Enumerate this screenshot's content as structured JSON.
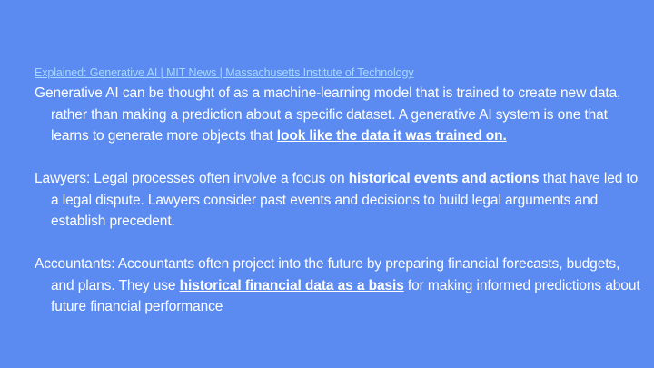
{
  "slide": {
    "source_link": "Explained: Generative AI | MIT News | Massachusetts Institute of Technology",
    "p1": {
      "text_a": "Generative AI can be thought of as a machine-learning model that is trained to create new data, rather than making a prediction about a specific dataset. A generative AI system is one that learns to generate more objects that ",
      "highlight": "look like the data it was trained on."
    },
    "p2": {
      "text_a": "Lawyers: Legal processes often involve a focus on ",
      "highlight": "historical events and actions",
      "text_b": " that have led to a legal dispute. Lawyers consider past events and decisions to build legal arguments and establish precedent."
    },
    "p3": {
      "text_a": "Accountants: Accountants often project into the future by preparing financial forecasts, budgets, and plans. They use ",
      "highlight": "historical financial data as a basis",
      "text_b": " for making informed predictions about future financial performance"
    }
  },
  "colors": {
    "background": "#5b8bf0",
    "text": "#ffffff",
    "link": "#a6d8ff"
  }
}
